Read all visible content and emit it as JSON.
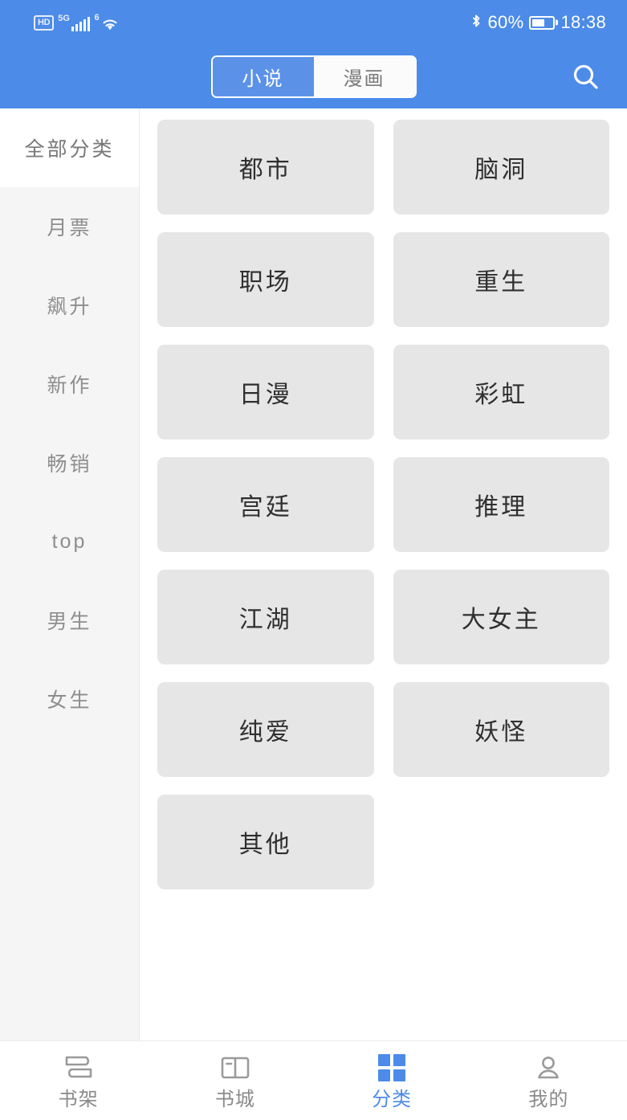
{
  "status_bar": {
    "hd_badge": "HD",
    "network_label": "5G",
    "wifi_generation": "6",
    "bluetooth_icon": "bluetooth-icon",
    "battery_percent": "60%",
    "battery_level": 60,
    "time": "18:38"
  },
  "header": {
    "segmented": {
      "selected_index": 0,
      "options": [
        {
          "label": "小说",
          "active": true
        },
        {
          "label": "漫画",
          "active": false
        }
      ]
    },
    "search_icon": "search-icon",
    "background_color": "#4c8be8"
  },
  "sidebar": {
    "selected_index": 0,
    "items": [
      {
        "label": "全部分类",
        "active": true
      },
      {
        "label": "月票",
        "active": false
      },
      {
        "label": "飙升",
        "active": false
      },
      {
        "label": "新作",
        "active": false
      },
      {
        "label": "畅销",
        "active": false
      },
      {
        "label": "top",
        "active": false
      },
      {
        "label": "男生",
        "active": false
      },
      {
        "label": "女生",
        "active": false
      }
    ]
  },
  "categories": [
    {
      "label": "都市"
    },
    {
      "label": "脑洞"
    },
    {
      "label": "职场"
    },
    {
      "label": "重生"
    },
    {
      "label": "日漫"
    },
    {
      "label": "彩虹"
    },
    {
      "label": "宫廷"
    },
    {
      "label": "推理"
    },
    {
      "label": "江湖"
    },
    {
      "label": "大女主"
    },
    {
      "label": "纯爱"
    },
    {
      "label": "妖怪"
    },
    {
      "label": "其他"
    }
  ],
  "bottom_nav": {
    "selected_index": 2,
    "items": [
      {
        "label": "书架",
        "icon": "bookshelf-icon",
        "active": false
      },
      {
        "label": "书城",
        "icon": "open-book-icon",
        "active": false
      },
      {
        "label": "分类",
        "icon": "grid-icon",
        "active": true
      },
      {
        "label": "我的",
        "icon": "person-icon",
        "active": false
      }
    ]
  },
  "colors": {
    "accent": "#4c8be8",
    "card_bg": "#e6e6e6",
    "sidebar_bg": "#f5f5f5",
    "inactive_text": "#8a8a8a"
  }
}
